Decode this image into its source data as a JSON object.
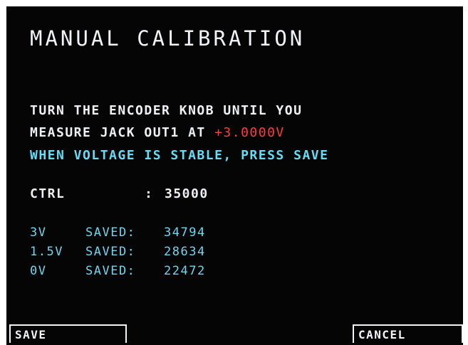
{
  "screen": {
    "title": "MANUAL CALIBRATION",
    "instructions": {
      "line1": "TURN THE ENCODER KNOB UNTIL YOU",
      "line2_prefix": "MEASURE JACK OUT1 AT ",
      "line2_target": "+3.0000V",
      "line3": "WHEN VOLTAGE IS STABLE, PRESS SAVE"
    },
    "ctrl": {
      "label": "CTRL",
      "separator": ":",
      "value": "35000"
    },
    "saved_values": [
      {
        "label": "3V",
        "saved_label": "SAVED:",
        "value": "34794"
      },
      {
        "label": "1.5V",
        "saved_label": "SAVED:",
        "value": "28634"
      },
      {
        "label": "0V",
        "saved_label": "SAVED:",
        "value": "22472"
      }
    ]
  },
  "buttons": {
    "save_label": "SAVE",
    "cancel_label": "CANCEL"
  },
  "colors": {
    "background": "#050506",
    "text_white": "#eef0f4",
    "text_cyan": "#64dcf6",
    "text_red": "#ff3b3b"
  }
}
